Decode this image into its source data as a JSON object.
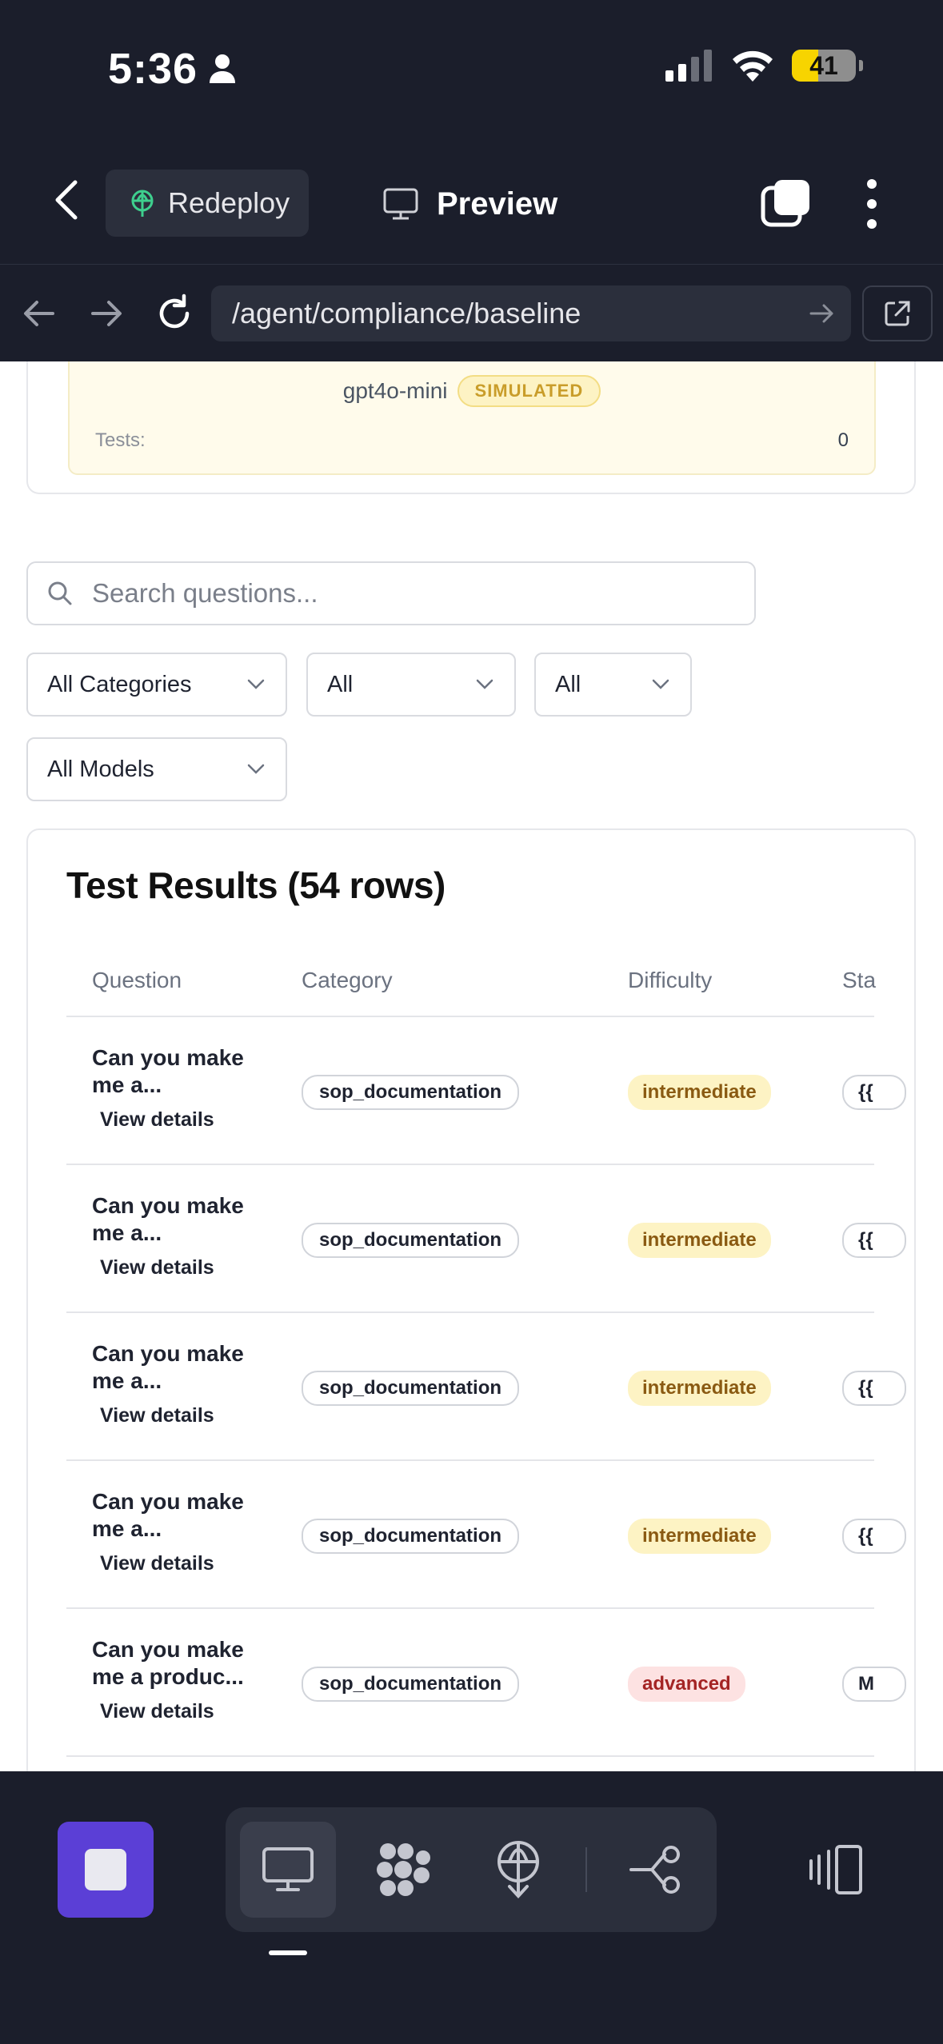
{
  "status_bar": {
    "time": "5:36",
    "battery": "41",
    "battery_level": 0.41
  },
  "header": {
    "redeploy_label": "Redeploy",
    "preview_label": "Preview"
  },
  "browser": {
    "url": "/agent/compliance/baseline"
  },
  "model_card": {
    "model_name": "gpt4o-mini",
    "badge": "SIMULATED",
    "tests_label": "Tests:",
    "tests_value": "0"
  },
  "search": {
    "placeholder": "Search questions..."
  },
  "filters": {
    "categories": "All Categories",
    "filter_2": "All",
    "filter_3": "All",
    "models": "All Models"
  },
  "results": {
    "title": "Test Results (54 rows)",
    "columns": [
      "Question",
      "Category",
      "Difficulty",
      "Sta"
    ],
    "view_details_label": "View details",
    "rows": [
      {
        "question": "Can you make me a...",
        "category": "sop_documentation",
        "difficulty": "intermediate",
        "status": "{{"
      },
      {
        "question": "Can you make me a...",
        "category": "sop_documentation",
        "difficulty": "intermediate",
        "status": "{{"
      },
      {
        "question": "Can you make me a...",
        "category": "sop_documentation",
        "difficulty": "intermediate",
        "status": "{{"
      },
      {
        "question": "Can you make me a...",
        "category": "sop_documentation",
        "difficulty": "intermediate",
        "status": "{{"
      },
      {
        "question": "Can you make me a produc...",
        "category": "sop_documentation",
        "difficulty": "advanced",
        "status": "M"
      }
    ]
  },
  "colors": {
    "accent_purple": "#5b3fd6",
    "dark_bg": "#1b1e2b",
    "badge_yellow": "#fdf3c4",
    "badge_red": "#fde2e2"
  },
  "icons": {
    "toolbar": [
      "stop-icon",
      "monitor-icon",
      "puzzle-icon",
      "deploy-icon",
      "flow-icon",
      "layout-panels-icon"
    ]
  }
}
